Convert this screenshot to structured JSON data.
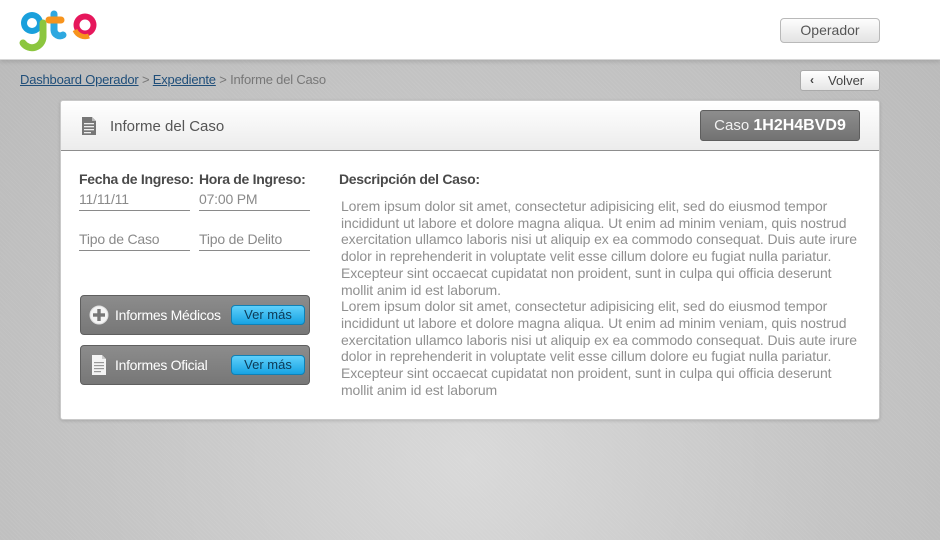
{
  "header": {
    "logo_text": "gto",
    "operator_button": "Operador"
  },
  "breadcrumb": {
    "items": [
      "Dashboard Operador",
      "Expediente"
    ],
    "separator": ">",
    "current": "Informe del Caso"
  },
  "back_button": {
    "icon": "chevron-left-icon",
    "label": "Volver"
  },
  "card": {
    "title": "Informe del Caso",
    "case_prefix": "Caso",
    "case_id": "1H2H4BVD9",
    "fields": {
      "fecha_label": "Fecha de Ingreso:",
      "fecha_value": "11/11/11",
      "hora_label": "Hora de Ingreso:",
      "hora_value": "07:00 PM",
      "tipo_caso_placeholder": "Tipo de Caso",
      "tipo_delito_placeholder": "Tipo de Delito"
    },
    "buttons": [
      {
        "label": "Informes Médicos",
        "action": "Ver más",
        "icon": "plus-circle-icon"
      },
      {
        "label": "Informes Oficial",
        "action": "Ver más",
        "icon": "document-icon"
      }
    ],
    "description_label": "Descripción del Caso:",
    "description_paragraphs": [
      "Lorem ipsum dolor sit amet, consectetur adipisicing elit, sed do eiusmod tempor incididunt ut labore et dolore magna aliqua. Ut enim ad minim veniam, quis nostrud exercitation ullamco laboris nisi ut aliquip ex ea commodo consequat. Duis aute irure dolor in reprehenderit in voluptate velit esse cillum dolore eu fugiat nulla pariatur. Excepteur sint occaecat cupidatat non proident, sunt in culpa qui officia deserunt mollit anim id est laborum.",
      "Lorem ipsum dolor sit amet, consectetur adipisicing elit, sed do eiusmod tempor incididunt ut labore et dolore magna aliqua. Ut enim ad minim veniam, quis nostrud exercitation ullamco laboris nisi ut aliquip ex ea commodo consequat. Duis aute irure dolor in reprehenderit in voluptate velit esse cillum dolore eu fugiat nulla pariatur. Excepteur sint occaecat cupidatat non proident, sunt in culpa qui officia deserunt mollit anim id est laborum"
    ]
  },
  "colors": {
    "accent_blue": "#17a3e3",
    "breadcrumb_link": "#1f4e79",
    "badge_gray": "#7f7f7f"
  }
}
